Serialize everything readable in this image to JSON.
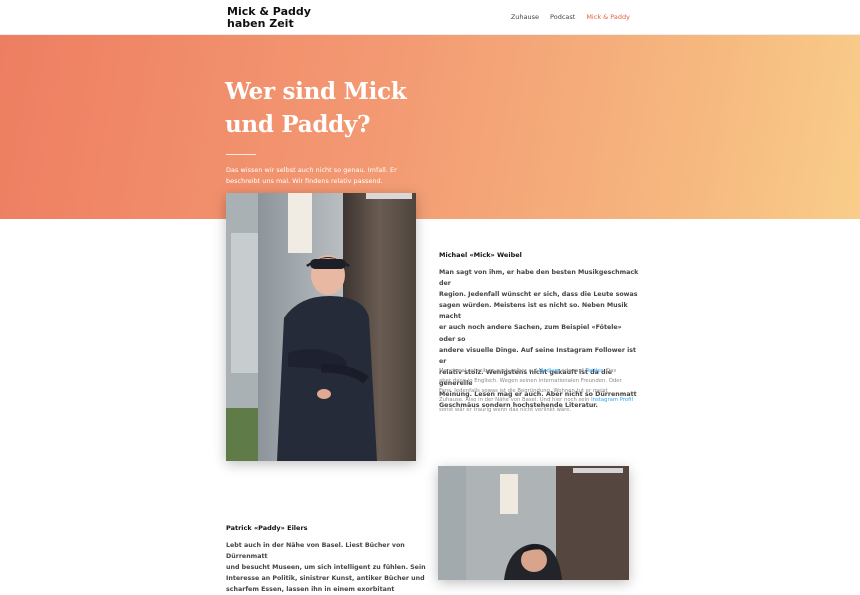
{
  "header": {
    "logo_line1": "Mick & Paddy",
    "logo_line2": "haben Zeit",
    "nav": [
      "Zuhause",
      "Podcast",
      "Mick & Paddy"
    ],
    "active_color": "#e2633f"
  },
  "hero": {
    "title_line1": "Wer sind Mick",
    "title_line2": "und Paddy?",
    "subtitle_line1": "Das wissen wir selbst auch nicht so genau. Imfall. Er",
    "subtitle_line2": "beschreibt uns mal. Wir findens relativ passend.",
    "gradient_colors": [
      "#ee7e61",
      "#f9cd8a"
    ]
  },
  "mick": {
    "name": "Michael «Mick» Weibel",
    "bold_lines": [
      "Man sagt von ihm, er habe den besten Musikgeschmack der",
      "Region. Jedenfall wünscht er sich, dass die Leute sowas",
      "sagen würden. Meistens ist es nicht so. Neben Musik macht",
      "er auch noch andere Sachen, zum Beispiel «Fötele» oder so",
      "andere visuelle Dinge. Auf seine Instagram Follower ist er",
      "relativ stolz. Wenigstens nicht gekauft ist da die generelle",
      "Meinung. Lesen mag er auch. Aber nicht so Dürrenmatt",
      "Geschmäus sondern hochstehende Literatur."
    ],
    "small_line1_a": "Manchmal schreib er auch selber auf ",
    "link_medium": "Medium",
    "small_line1_b": " oder auf ",
    "link_twitter": "Twitter",
    "small_line1_c": ". Das",
    "small_line2": "aber dann in Englisch. Wegen seinen internationalen Freunden. Oder",
    "small_line3": "Fans. Jedenfalls sowas ist die Begründung. Wohnen tut er meist",
    "small_line4": "Zuhause. Also in der Nähe von Basel. Und hier noch sein ",
    "link_instagram": "Instagram Profil",
    "small_line5": "sonst wär er traurig wenn das nicht verlinkt wäre.",
    "link_color": "#2ea3f2"
  },
  "paddy": {
    "name": "Patrick «Paddy» Eilers",
    "bold_lines": [
      "Lebt auch in der Nähe von Basel. Liest Bücher von Dürrenmatt",
      "und besucht Museen, um sich intelligent zu fühlen. Sein",
      "Interesse an Politik, sinistrer Kunst, antiker Bücher und",
      "scharfem Essen, lassen ihn in einem exorbitant"
    ]
  }
}
